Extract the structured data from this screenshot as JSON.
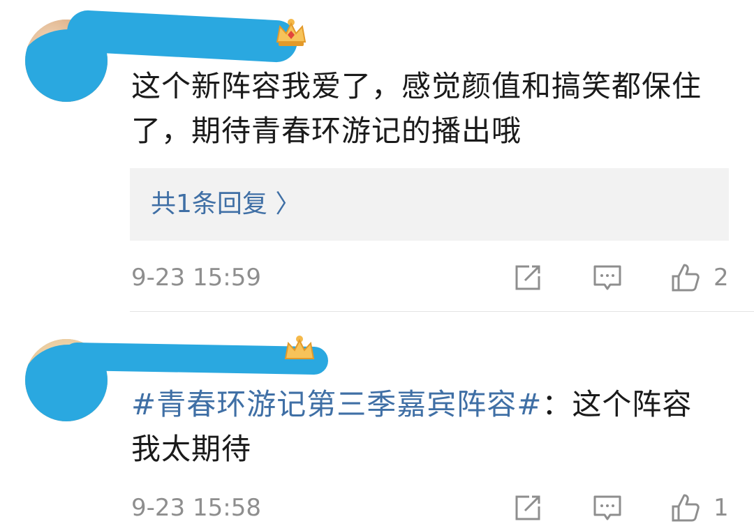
{
  "comments": [
    {
      "text": "这个新阵容我爱了，感觉颜值和搞笑都保住了，期待青春环游记的播出哦",
      "reply_summary": "共1条回复 〉",
      "timestamp": "9-23 15:59",
      "like_count": "2"
    },
    {
      "topic": "#青春环游记第三季嘉宾阵容#",
      "text": "：这个阵容我太期待",
      "timestamp": "9-23 15:58",
      "like_count": "1"
    }
  ],
  "icons": {
    "share": "share-icon",
    "comment": "comment-icon",
    "like": "thumbs-up-icon",
    "badge": "crown-icon"
  },
  "colors": {
    "link": "#3f6fa5",
    "redaction": "#2aa8e0",
    "meta": "#8e8e8e",
    "reply_bg": "#f2f2f2"
  }
}
